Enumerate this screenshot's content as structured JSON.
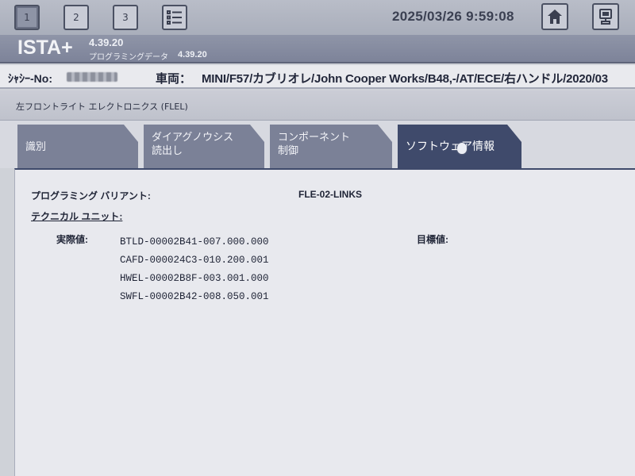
{
  "toolbar": {
    "buttons": [
      "1",
      "2",
      "3"
    ],
    "datetime": "2025/03/26 9:59:08",
    "icons": {
      "list": "list-icon",
      "home": "home-icon",
      "connection": "vehicle-connection-icon"
    }
  },
  "app": {
    "name": "ISTA+",
    "version": "4.39.20",
    "data_label": "プログラミングデータ",
    "data_version": "4.39.20"
  },
  "vehicle": {
    "chassis_label": "ｼｬｼｰ-No:",
    "model_label": "車両：",
    "model_value": "MINI/F57/カブリオレ/John Cooper Works/B48,-/AT/ECE/右ハンドル/2020/03"
  },
  "section": {
    "title": "左フロントライト エレクトロニクス (FLEL)"
  },
  "tabs": [
    {
      "lines": [
        "識別"
      ]
    },
    {
      "lines": [
        "ダイアグノウシス",
        "読出し"
      ]
    },
    {
      "lines": [
        "コンポーネント",
        "制御"
      ]
    },
    {
      "lines": [
        "ソフトウェア情報"
      ],
      "active": true
    }
  ],
  "content": {
    "variant_label": "プログラミング バリアント:",
    "variant_value": "FLE-02-LINKS",
    "tech_unit_label": "テクニカル ユニット:",
    "actual_label": "実際値:",
    "target_label": "目標値:",
    "software": [
      "BTLD-00002B41-007.000.000",
      "CAFD-000024C3-010.200.001",
      "HWEL-00002B8F-003.001.000",
      "SWFL-00002B42-008.050.001"
    ]
  },
  "colors": {
    "active_tab": "#3f4a6b",
    "inactive_tab": "#7b8197",
    "title_bar": "#8f95a8"
  }
}
